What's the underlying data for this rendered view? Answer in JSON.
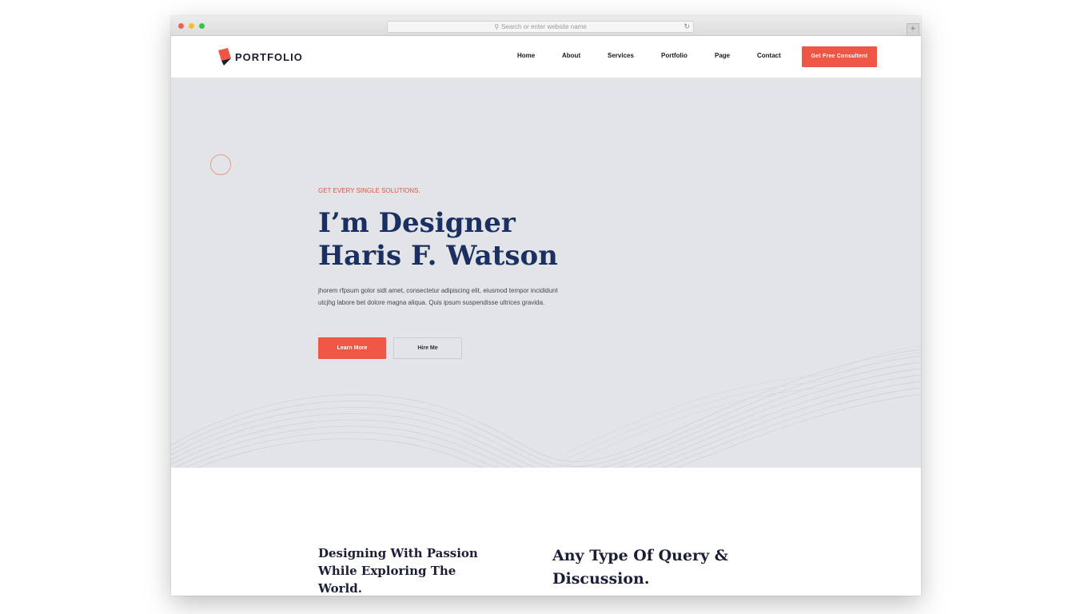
{
  "browser": {
    "url_placeholder": "Search or enter website name"
  },
  "nav": {
    "logo_text": "PORTFOLIO",
    "items": [
      "Home",
      "About",
      "Services",
      "Portfolio",
      "Page",
      "Contact"
    ],
    "cta_label": "Get Free Consultent"
  },
  "hero": {
    "eyebrow": "GET EVERY SINGLE SOLUTIONS.",
    "headline_line1": "I’m Designer",
    "headline_line2": "Haris F. Watson",
    "description": "jhorem rfpsum golor sidt amet, consectetur adipiscing elit, eiusmod tempor incididunt utcjhg labore bet dolore magna aliqua. Quis ipsum suspendisse ultrices gravida.",
    "learn_more_label": "Learn More",
    "hire_me_label": "Hire Me"
  },
  "section2": {
    "left_title": "Designing With Passion While Exploring The World.",
    "right_title": "Any Type Of Query & Discussion."
  },
  "colors": {
    "accent": "#ee5645",
    "headline": "#1b3060",
    "hero_bg": "#e2e4e8"
  }
}
